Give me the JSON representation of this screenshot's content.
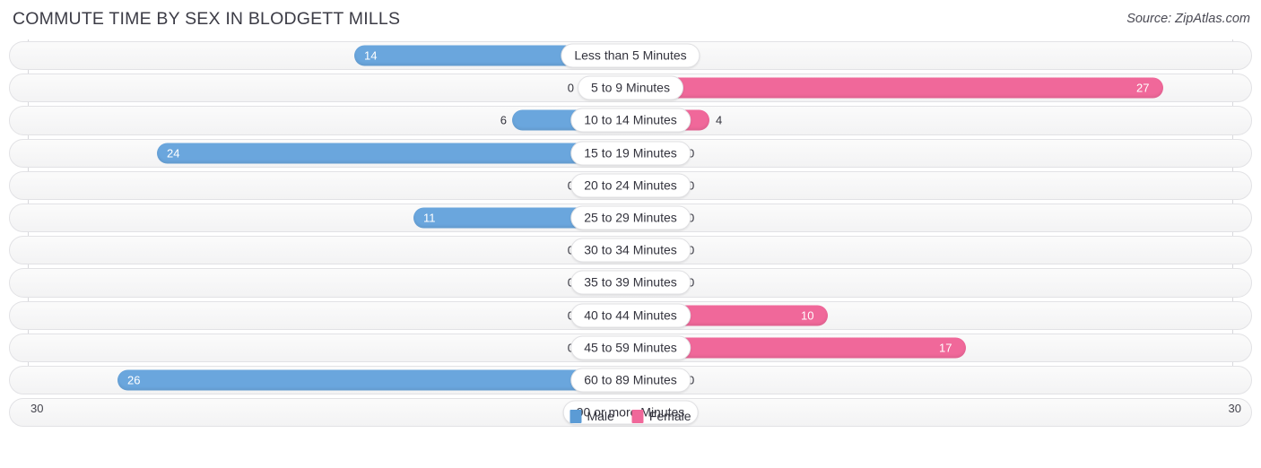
{
  "header": {
    "title": "COMMUTE TIME BY SEX IN BLODGETT MILLS",
    "source": "Source: ZipAtlas.com"
  },
  "legend": {
    "male_label": "Male",
    "female_label": "Female",
    "male_color": "#5b9bd5",
    "female_color": "#f0689a"
  },
  "axis": {
    "left_tick": "30",
    "right_tick": "30"
  },
  "colors": {
    "male": "#6aa6dd",
    "male_zero": "#a8c8ec",
    "female": "#f0689a",
    "female_zero": "#f9a8c2",
    "track": "#f5f5f6",
    "gridline": "#d8d8dc"
  },
  "chart_data": {
    "type": "bar",
    "orientation": "horizontal",
    "layout": "diverging-bidirectional",
    "title": "COMMUTE TIME BY SEX IN BLODGETT MILLS",
    "xlabel": "",
    "ylabel": "",
    "xlim": [
      30,
      30
    ],
    "axis_max": 30,
    "grid": true,
    "legend_position": "bottom-center",
    "categories": [
      "Less than 5 Minutes",
      "5 to 9 Minutes",
      "10 to 14 Minutes",
      "15 to 19 Minutes",
      "20 to 24 Minutes",
      "25 to 29 Minutes",
      "30 to 34 Minutes",
      "35 to 39 Minutes",
      "40 to 44 Minutes",
      "45 to 59 Minutes",
      "60 to 89 Minutes",
      "90 or more Minutes"
    ],
    "series": [
      {
        "name": "Male",
        "direction": "left",
        "color": "#5b9bd5",
        "values": [
          14,
          0,
          6,
          24,
          0,
          11,
          0,
          0,
          0,
          0,
          26,
          0
        ]
      },
      {
        "name": "Female",
        "direction": "right",
        "color": "#f0689a",
        "values": [
          0,
          27,
          4,
          0,
          0,
          0,
          0,
          0,
          10,
          17,
          0,
          0
        ]
      }
    ]
  },
  "rows": [
    {
      "label": "Less than 5 Minutes",
      "male": "14",
      "female": "0"
    },
    {
      "label": "5 to 9 Minutes",
      "male": "0",
      "female": "27"
    },
    {
      "label": "10 to 14 Minutes",
      "male": "6",
      "female": "4"
    },
    {
      "label": "15 to 19 Minutes",
      "male": "24",
      "female": "0"
    },
    {
      "label": "20 to 24 Minutes",
      "male": "0",
      "female": "0"
    },
    {
      "label": "25 to 29 Minutes",
      "male": "11",
      "female": "0"
    },
    {
      "label": "30 to 34 Minutes",
      "male": "0",
      "female": "0"
    },
    {
      "label": "35 to 39 Minutes",
      "male": "0",
      "female": "0"
    },
    {
      "label": "40 to 44 Minutes",
      "male": "0",
      "female": "10"
    },
    {
      "label": "45 to 59 Minutes",
      "male": "0",
      "female": "17"
    },
    {
      "label": "60 to 89 Minutes",
      "male": "26",
      "female": "0"
    },
    {
      "label": "90 or more Minutes",
      "male": "0",
      "female": "0"
    }
  ]
}
